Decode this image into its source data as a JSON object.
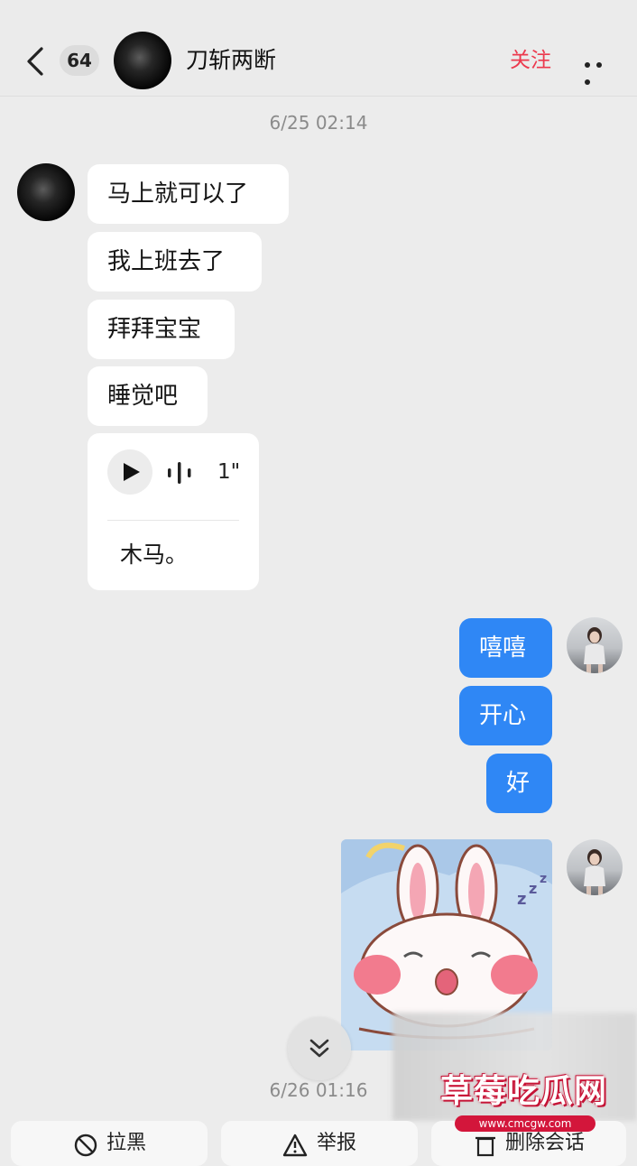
{
  "header": {
    "back_icon": "chevron-left-icon",
    "unread_count": "64",
    "contact_name": "刀斩两断",
    "follow_label": "关注",
    "more_icon": "more-dots-icon"
  },
  "timestamps": [
    "6/25 02:14",
    "6/26 01:16"
  ],
  "incoming": [
    {
      "text": "马上就可以了"
    },
    {
      "text": "我上班去了"
    },
    {
      "text": "拜拜宝宝"
    },
    {
      "text": "睡觉吧"
    }
  ],
  "voice_message": {
    "duration": "1\"",
    "transcript": "木马。"
  },
  "outgoing": [
    {
      "text": "嘻嘻"
    },
    {
      "text": "开心"
    },
    {
      "text": "好"
    }
  ],
  "sticker": {
    "description_icon": "bunny-sleeping-sticker"
  },
  "bottom_actions": [
    {
      "label": "拉黑",
      "icon": "block-icon"
    },
    {
      "label": "举报",
      "icon": "warning-icon"
    },
    {
      "label": "删除会话",
      "icon": "trash-icon"
    }
  ],
  "watermark": {
    "title": "草莓吃瓜网",
    "url": "www.cmcgw.com"
  },
  "colors": {
    "accent_follow": "#ec3a4e",
    "bubble_out": "#2f87f5",
    "bubble_in": "#ffffff",
    "background": "#ececec"
  }
}
